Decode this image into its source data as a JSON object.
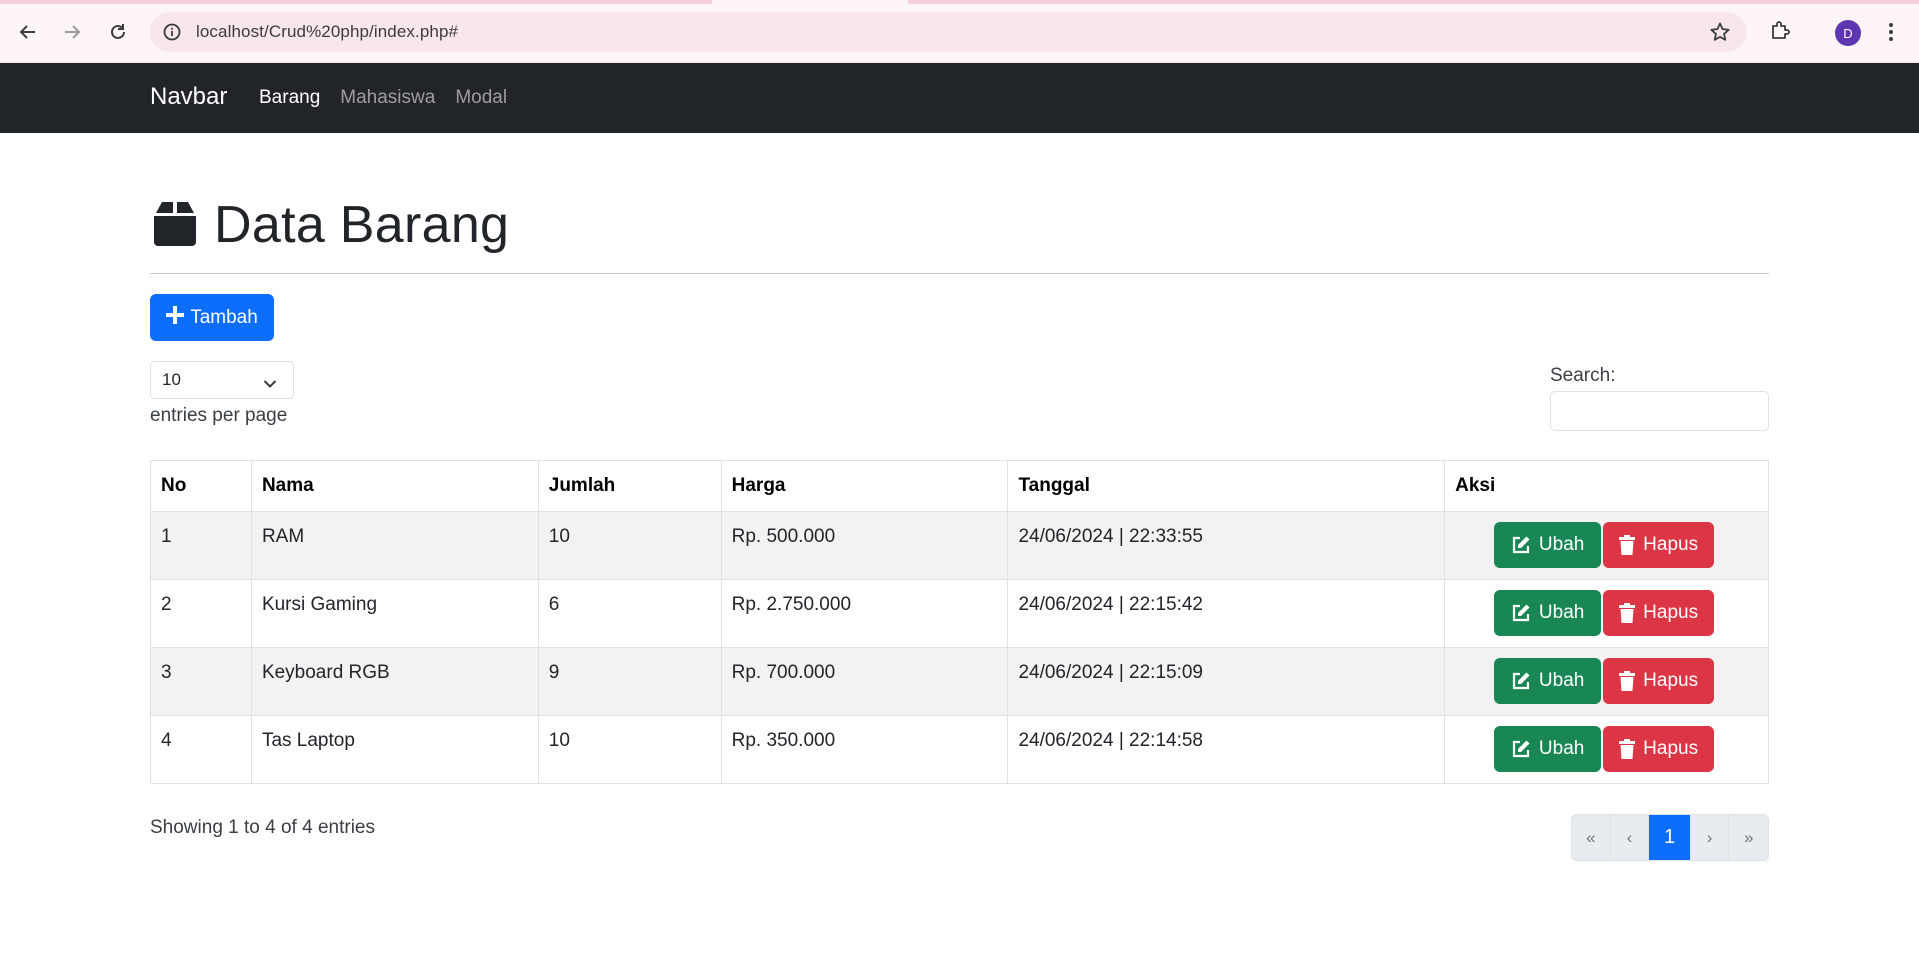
{
  "browser": {
    "url": "localhost/Crud%20php/index.php#",
    "profile_initial": "D"
  },
  "navbar": {
    "brand": "Navbar",
    "links": [
      {
        "label": "Barang",
        "active": true
      },
      {
        "label": "Mahasiswa",
        "active": false
      },
      {
        "label": "Modal",
        "active": false
      }
    ]
  },
  "page": {
    "title": "Data Barang",
    "add_button": "Tambah",
    "entries_value": "10",
    "entries_label": "entries per page",
    "search_label": "Search:",
    "search_value": ""
  },
  "table": {
    "headers": [
      "No",
      "Nama",
      "Jumlah",
      "Harga",
      "Tanggal",
      "Aksi"
    ],
    "rows": [
      {
        "no": "1",
        "nama": "RAM",
        "jumlah": "10",
        "harga": "Rp. 500.000",
        "tanggal": "24/06/2024 | 22:33:55"
      },
      {
        "no": "2",
        "nama": "Kursi Gaming",
        "jumlah": "6",
        "harga": "Rp. 2.750.000",
        "tanggal": "24/06/2024 | 22:15:42"
      },
      {
        "no": "3",
        "nama": "Keyboard RGB",
        "jumlah": "9",
        "harga": "Rp. 700.000",
        "tanggal": "24/06/2024 | 22:15:09"
      },
      {
        "no": "4",
        "nama": "Tas Laptop",
        "jumlah": "10",
        "harga": "Rp. 350.000",
        "tanggal": "24/06/2024 | 22:14:58"
      }
    ],
    "edit_label": "Ubah",
    "delete_label": "Hapus"
  },
  "footer": {
    "showing": "Showing 1 to 4 of 4 entries",
    "pager": {
      "first": "«",
      "prev": "‹",
      "current": "1",
      "next": "›",
      "last": "»"
    }
  },
  "colors": {
    "primary": "#0d6efd",
    "success": "#198754",
    "danger": "#dc3545",
    "navbar": "#212529"
  },
  "icons": {
    "title": "box-icon",
    "add": "plus-icon",
    "edit": "pen-square-icon",
    "delete": "trash-icon"
  }
}
